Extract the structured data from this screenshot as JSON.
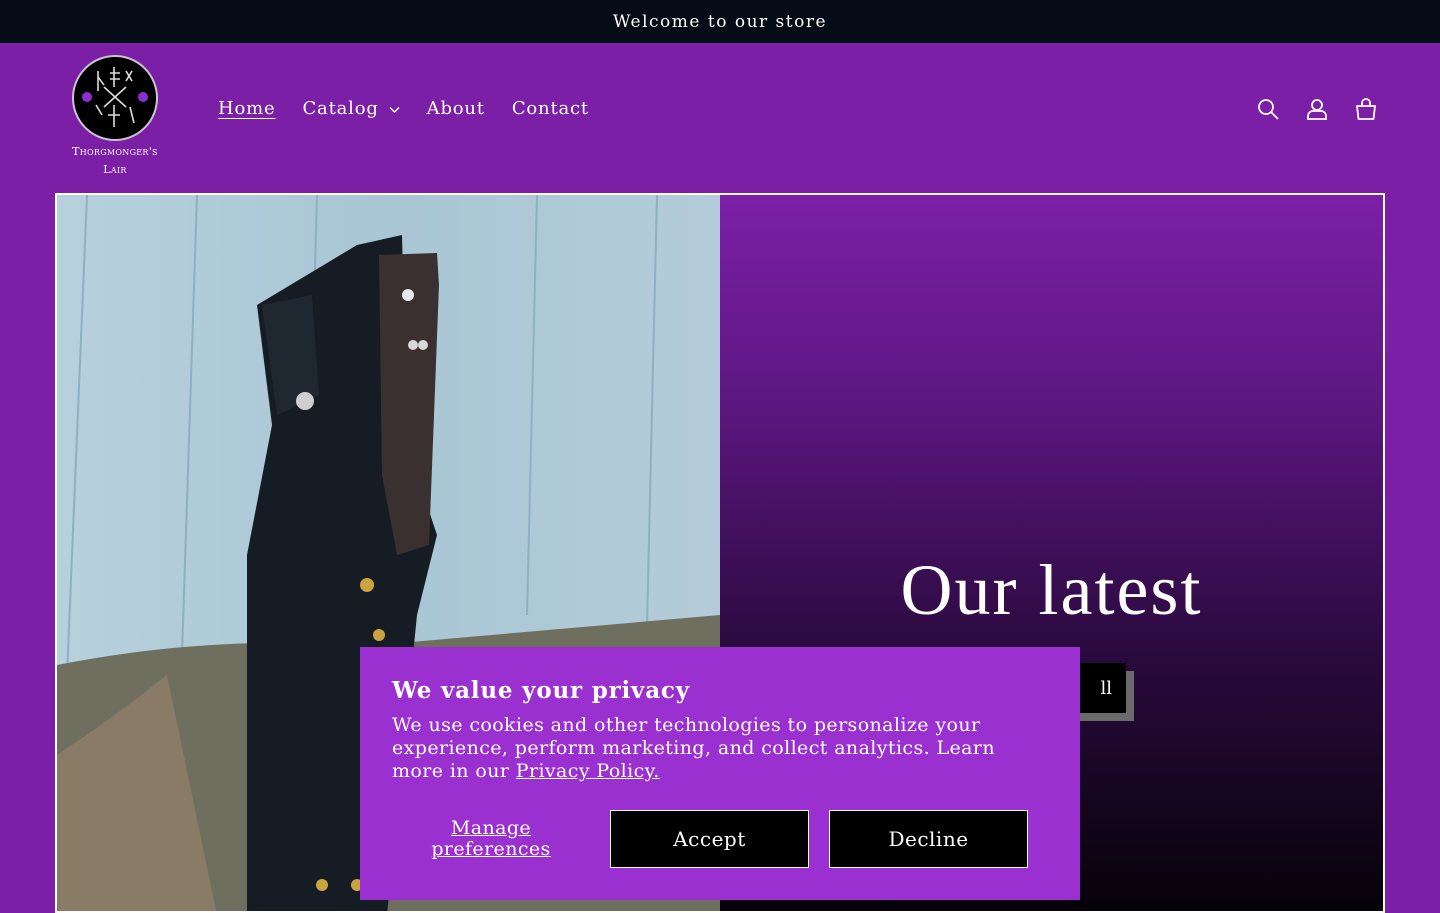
{
  "announcement": "Welcome to our store",
  "logo": {
    "text_line1": "Thorgmonger's",
    "text_line2": "Lair"
  },
  "nav": [
    {
      "label": "Home"
    },
    {
      "label": "Catalog"
    },
    {
      "label": "About"
    },
    {
      "label": "Contact"
    }
  ],
  "header_icons": [
    "search-icon",
    "account-icon",
    "cart-icon"
  ],
  "hero": {
    "heading": "Our latest",
    "button_label": "ll",
    "image_alt": "knife-and-sheath-image"
  },
  "consent": {
    "title": "We value your privacy",
    "body": "We use cookies and other technologies to personalize your experience, perform marketing, and collect analytics. Learn more in our ",
    "link": "Privacy Policy.",
    "manage_label": "Manage preferences",
    "accept_label": "Accept",
    "decline_label": "Decline"
  },
  "colors": {
    "header_bg": "#7c1fa7",
    "announce_bg": "#050c17",
    "consent_bg": "#9b30d0",
    "button_bg": "#000000"
  }
}
